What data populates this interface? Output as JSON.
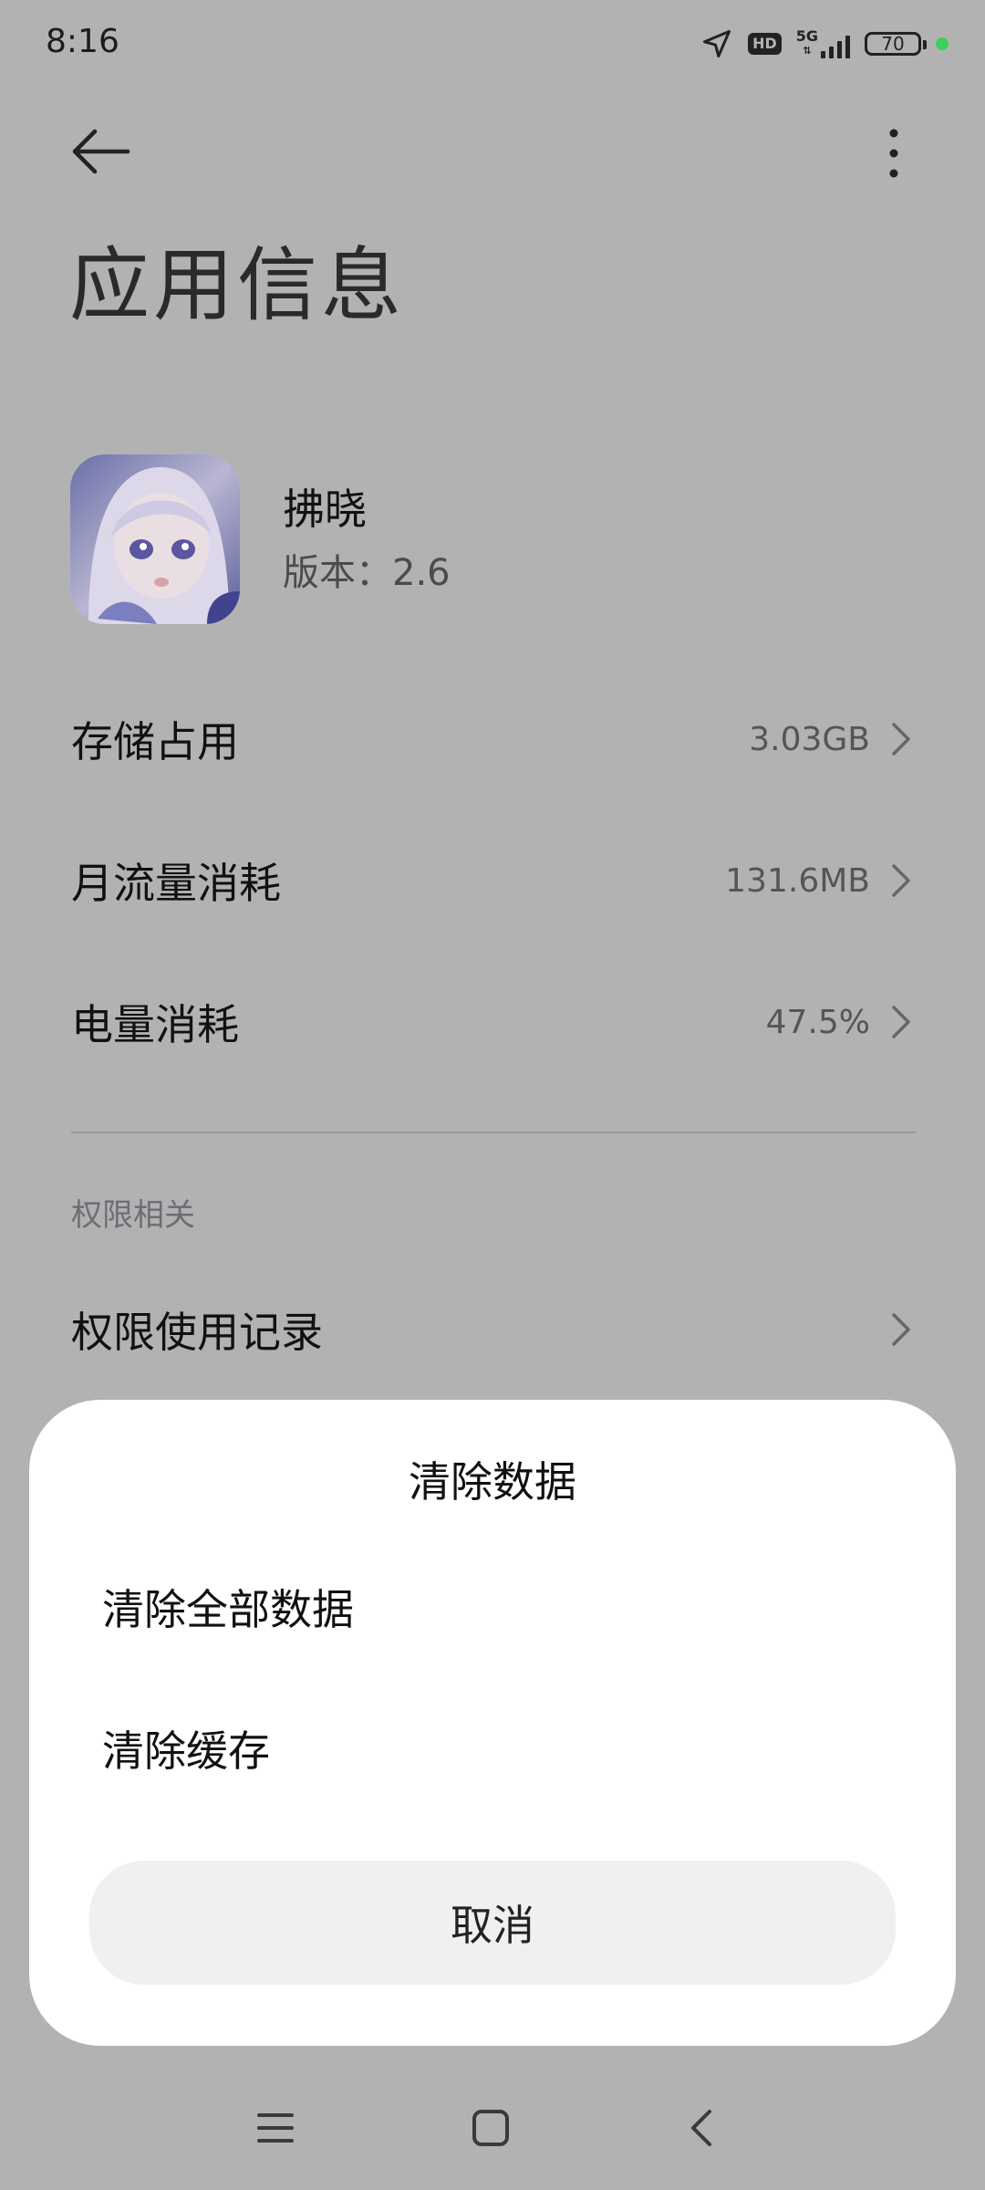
{
  "status_bar": {
    "time": "8:16",
    "hd_label": "HD",
    "network_label": "5G",
    "battery_level": "70",
    "icons": [
      "location-arrow-icon",
      "hd-icon",
      "signal-icon",
      "battery-icon",
      "privacy-indicator-dot"
    ],
    "indicator_color": "#3ecf5a"
  },
  "header": {
    "back_icon": "arrow-left-icon",
    "more_icon": "more-vertical-icon",
    "title": "应用信息"
  },
  "app": {
    "name": "拂晓",
    "version": "版本：2.6"
  },
  "rows": [
    {
      "label": "存储占用",
      "value": "3.03GB"
    },
    {
      "label": "月流量消耗",
      "value": "131.6MB"
    },
    {
      "label": "电量消耗",
      "value": "47.5%"
    }
  ],
  "permissions": {
    "section_title": "权限相关",
    "usage_record_label": "权限使用记录"
  },
  "dialog": {
    "title": "清除数据",
    "options": [
      "清除全部数据",
      "清除缓存"
    ],
    "cancel_label": "取消"
  },
  "navbar": {
    "icons": [
      "menu-icon",
      "home-icon",
      "back-icon"
    ]
  },
  "colors": {
    "scrim_background": "#b2b2b2",
    "sheet_background": "#ffffff",
    "cancel_background": "#f0f0f0"
  }
}
